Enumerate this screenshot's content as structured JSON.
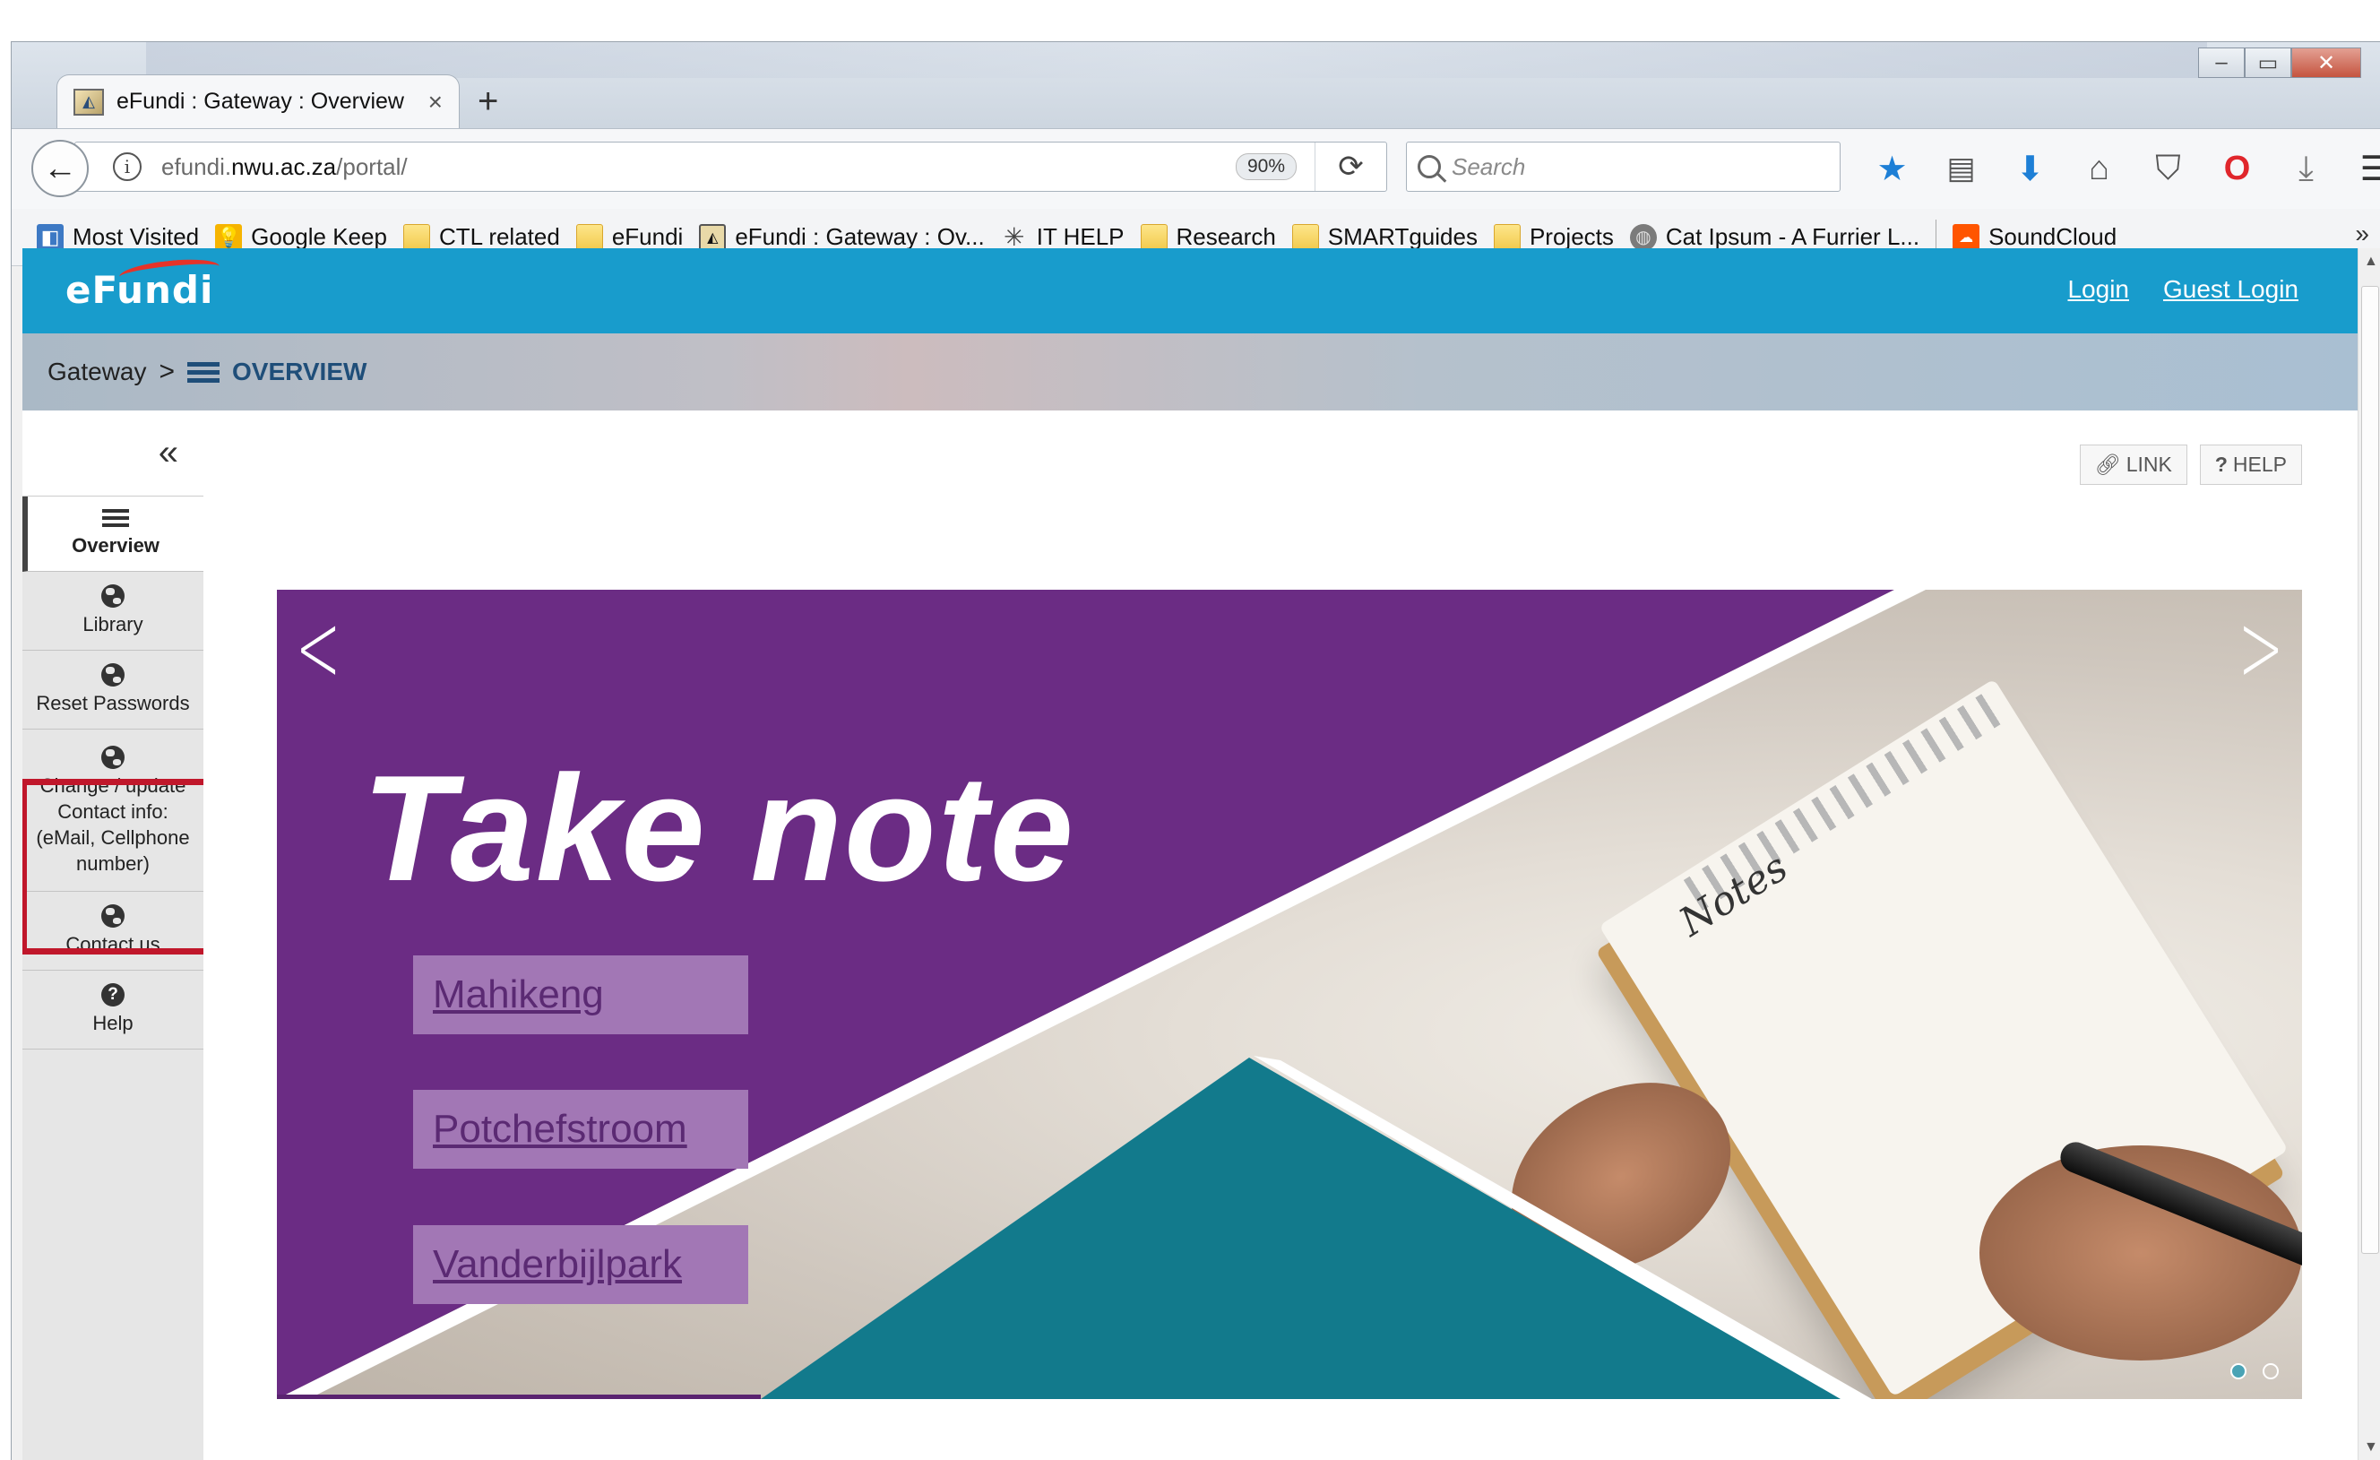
{
  "browser": {
    "tab_title": "eFundi : Gateway : Overview",
    "tab_close": "×",
    "new_tab": "+",
    "url_prefix": "efundi.",
    "url_domain": "nwu.ac.za",
    "url_path": "/portal/",
    "zoom": "90%",
    "search_placeholder": "Search",
    "bookmarks": [
      {
        "label": "Most Visited",
        "icon": "most-visited-icon"
      },
      {
        "label": "Google Keep",
        "icon": "google-keep-icon"
      },
      {
        "label": "CTL related",
        "icon": "folder-icon"
      },
      {
        "label": "eFundi",
        "icon": "folder-icon"
      },
      {
        "label": "eFundi : Gateway : Ov...",
        "icon": "efundi-favicon-icon"
      },
      {
        "label": "IT HELP",
        "icon": "it-help-icon"
      },
      {
        "label": "Research",
        "icon": "folder-icon"
      },
      {
        "label": "SMARTguides",
        "icon": "folder-icon"
      },
      {
        "label": "Projects",
        "icon": "folder-icon"
      },
      {
        "label": "Cat Ipsum - A Furrier L...",
        "icon": "globe-icon"
      },
      {
        "label": "SoundCloud",
        "icon": "soundcloud-icon"
      }
    ],
    "bookmarks_more": "»"
  },
  "site": {
    "logo": "eFundi",
    "login": "Login",
    "guest_login": "Guest Login",
    "breadcrumb_root": "Gateway",
    "breadcrumb_sep": ">",
    "breadcrumb_current": "OVERVIEW",
    "collapse": "«",
    "link_button": "LINK",
    "help_button": "HELP"
  },
  "sidebar": {
    "items": [
      {
        "label": "Overview",
        "active": true
      },
      {
        "label": "Library"
      },
      {
        "label": "Reset Passwords"
      },
      {
        "label": "Change / update Contact info: (eMail, Cellphone number)",
        "highlighted": true
      },
      {
        "label": "Contact us"
      },
      {
        "label": "Help"
      }
    ]
  },
  "carousel": {
    "caption": "Take note",
    "notepad_text": "Notes",
    "campuses": [
      "Mahikeng",
      "Potchefstroom",
      "Vanderbijlpark"
    ],
    "prev": "<",
    "next": ">",
    "slides": 2,
    "active_slide": 1
  },
  "colors": {
    "header": "#189ccc",
    "purple": "#6b2c84",
    "teal": "#127a8c",
    "highlight": "#c0172b"
  }
}
